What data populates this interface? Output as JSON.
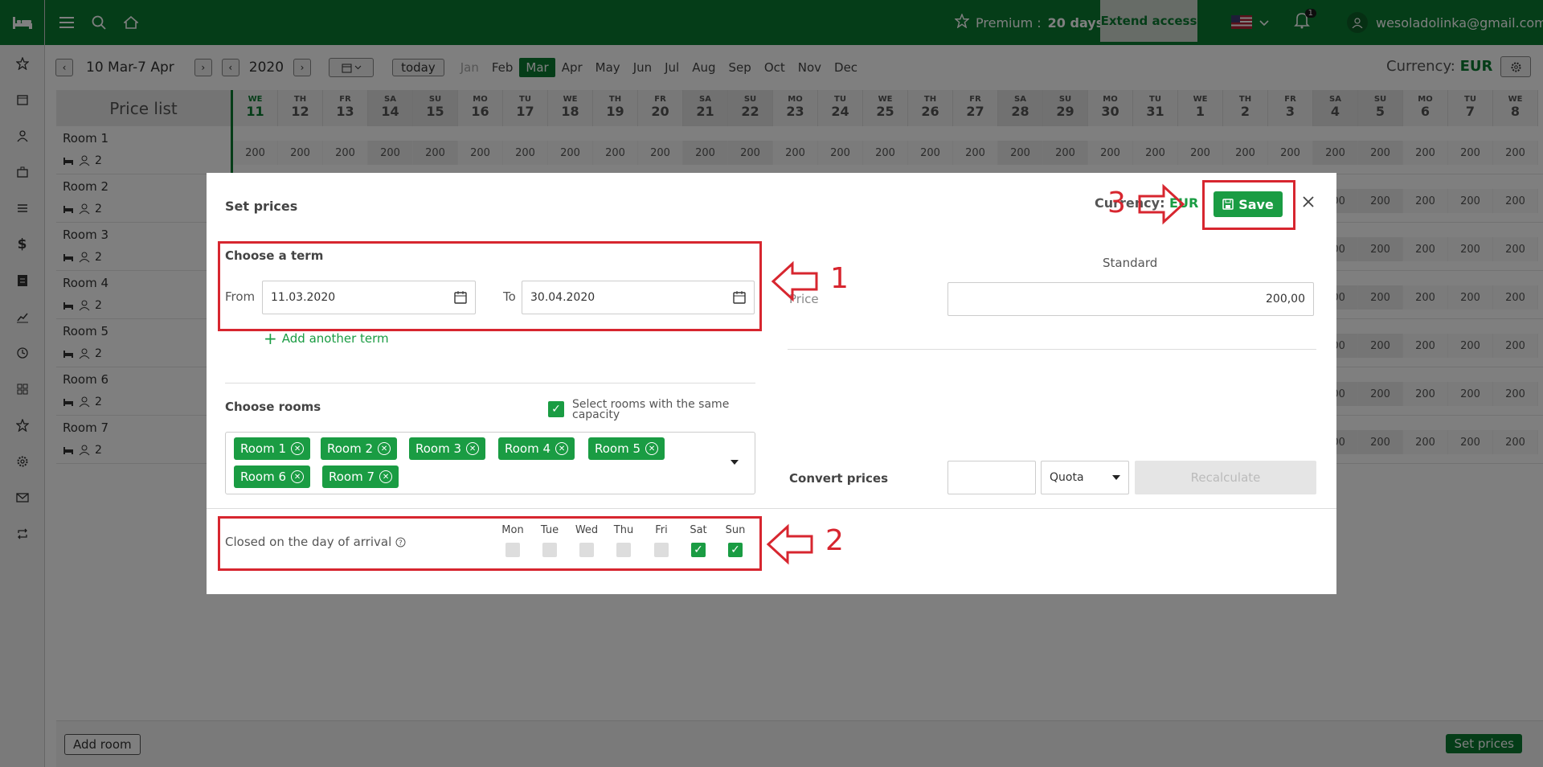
{
  "topbar": {
    "premium_label": "Premium :",
    "premium_days": "20 days",
    "extend_label": "Extend access",
    "notif_count": "1",
    "user_email": "wesoladolinka@gmail.com"
  },
  "nav": {
    "period": "10 Mar-7 Apr",
    "year": "2020",
    "today_label": "today",
    "months": [
      "Jan",
      "Feb",
      "Mar",
      "Apr",
      "May",
      "Jun",
      "Jul",
      "Aug",
      "Sep",
      "Oct",
      "Nov",
      "Dec"
    ],
    "active_month": "Mar",
    "currency_label": "Currency:",
    "currency_value": "EUR"
  },
  "grid": {
    "price_list_label": "Price list",
    "days": [
      {
        "n": "WE",
        "d": "11",
        "we": false,
        "today": true
      },
      {
        "n": "TH",
        "d": "12",
        "we": false
      },
      {
        "n": "FR",
        "d": "13",
        "we": false
      },
      {
        "n": "SA",
        "d": "14",
        "we": true
      },
      {
        "n": "SU",
        "d": "15",
        "we": true
      },
      {
        "n": "MO",
        "d": "16",
        "we": false
      },
      {
        "n": "TU",
        "d": "17",
        "we": false
      },
      {
        "n": "WE",
        "d": "18",
        "we": false
      },
      {
        "n": "TH",
        "d": "19",
        "we": false
      },
      {
        "n": "FR",
        "d": "20",
        "we": false
      },
      {
        "n": "SA",
        "d": "21",
        "we": true
      },
      {
        "n": "SU",
        "d": "22",
        "we": true
      },
      {
        "n": "MO",
        "d": "23",
        "we": false
      },
      {
        "n": "TU",
        "d": "24",
        "we": false
      },
      {
        "n": "WE",
        "d": "25",
        "we": false
      },
      {
        "n": "TH",
        "d": "26",
        "we": false
      },
      {
        "n": "FR",
        "d": "27",
        "we": false
      },
      {
        "n": "SA",
        "d": "28",
        "we": true
      },
      {
        "n": "SU",
        "d": "29",
        "we": true
      },
      {
        "n": "MO",
        "d": "30",
        "we": false
      },
      {
        "n": "TU",
        "d": "31",
        "we": false
      },
      {
        "n": "WE",
        "d": "1",
        "we": false
      },
      {
        "n": "TH",
        "d": "2",
        "we": false
      },
      {
        "n": "FR",
        "d": "3",
        "we": false
      },
      {
        "n": "SA",
        "d": "4",
        "we": true
      },
      {
        "n": "SU",
        "d": "5",
        "we": true
      },
      {
        "n": "MO",
        "d": "6",
        "we": false
      },
      {
        "n": "TU",
        "d": "7",
        "we": false
      },
      {
        "n": "WE",
        "d": "8",
        "we": false
      }
    ],
    "rooms": [
      {
        "name": "Room 1",
        "capacity": "2"
      },
      {
        "name": "Room 2",
        "capacity": "2"
      },
      {
        "name": "Room 3",
        "capacity": "2"
      },
      {
        "name": "Room 4",
        "capacity": "2"
      },
      {
        "name": "Room 5",
        "capacity": "2"
      },
      {
        "name": "Room 6",
        "capacity": "2"
      },
      {
        "name": "Room 7",
        "capacity": "2"
      }
    ],
    "price": "200"
  },
  "footer": {
    "add_room": "Add room",
    "set_prices": "Set prices"
  },
  "modal": {
    "title": "Set prices",
    "currency_label": "Currency:",
    "currency_value": "EUR",
    "save_label": "Save",
    "term_title": "Choose a term",
    "from_label": "From",
    "from_value": "11.03.2020",
    "to_label": "To",
    "to_value": "30.04.2020",
    "add_term": "Add another term",
    "standard_label": "Standard",
    "price_label": "Price",
    "price_value": "200,00",
    "rooms_title": "Choose rooms",
    "same_capacity_label": "Select rooms with the same capacity",
    "selected_rooms": [
      "Room 1",
      "Room 2",
      "Room 3",
      "Room 4",
      "Room 5",
      "Room 6",
      "Room 7"
    ],
    "convert_label": "Convert prices",
    "quota_label": "Quota",
    "recalculate_label": "Recalculate",
    "closed_label": "Closed on the day of arrival",
    "weekdays": [
      {
        "label": "Mon",
        "checked": false
      },
      {
        "label": "Tue",
        "checked": false
      },
      {
        "label": "Wed",
        "checked": false
      },
      {
        "label": "Thu",
        "checked": false
      },
      {
        "label": "Fri",
        "checked": false
      },
      {
        "label": "Sat",
        "checked": true
      },
      {
        "label": "Sun",
        "checked": true
      }
    ]
  },
  "annotations": {
    "n1": "1",
    "n2": "2",
    "n3": "3"
  },
  "colors": {
    "brand_green": "#0a7a31",
    "accent_green": "#1a9c43",
    "annotation_red": "#d7262f"
  }
}
